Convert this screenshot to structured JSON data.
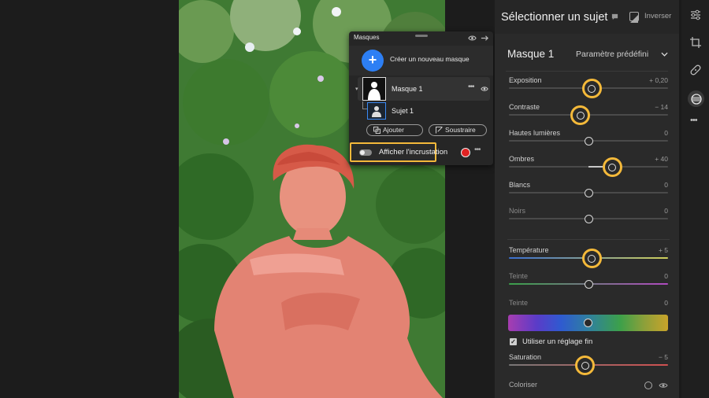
{
  "masks_panel": {
    "title": "Masques",
    "create_label": "Créer un nouveau masque",
    "create_symbol": "+",
    "mask_name": "Masque 1",
    "subject_name": "Sujet 1",
    "add_label": "Ajouter",
    "subtract_label": "Soustraire",
    "overlay_label": "Afficher l'incrustation",
    "overlay_color": "#e02222",
    "more_symbol": "•••"
  },
  "edit_panel": {
    "title": "Sélectionner un sujet",
    "invert_label": "Inverser",
    "mask_title": "Masque 1",
    "preset_label": "Paramètre prédéfini",
    "fine_tune_label": "Utiliser un réglage fin",
    "fine_tune_checked": true,
    "colorize_label": "Coloriser",
    "highlight_color": "#f4b93a",
    "sliders": [
      {
        "key": "exposure",
        "label": "Exposition",
        "value": "+ 0,20",
        "pos": 0.52,
        "highlight": true
      },
      {
        "key": "contrast",
        "label": "Contraste",
        "value": "− 14",
        "pos": 0.45,
        "highlight": true
      },
      {
        "key": "highlights",
        "label": "Hautes lumières",
        "value": "0",
        "pos": 0.5,
        "highlight": false
      },
      {
        "key": "shadows",
        "label": "Ombres",
        "value": "+ 40",
        "pos": 0.65,
        "highlight": true
      },
      {
        "key": "whites",
        "label": "Blancs",
        "value": "0",
        "pos": 0.5,
        "highlight": false
      },
      {
        "key": "blacks",
        "label": "Noirs",
        "value": "0",
        "pos": 0.5,
        "highlight": false,
        "dim": true
      },
      {
        "key": "temperature",
        "label": "Température",
        "value": "+ 5",
        "pos": 0.52,
        "highlight": true
      },
      {
        "key": "tint",
        "label": "Teinte",
        "value": "0",
        "pos": 0.5,
        "highlight": false,
        "dim": true
      },
      {
        "key": "hue",
        "label": "Teinte",
        "value": "0",
        "pos": 0.5,
        "highlight": false,
        "dim": true
      },
      {
        "key": "saturation",
        "label": "Saturation",
        "value": "− 5",
        "pos": 0.48,
        "highlight": true
      }
    ]
  },
  "tool_rail": {
    "icons": [
      "sliders-icon",
      "crop-icon",
      "healing-icon",
      "masking-icon",
      "more-icon"
    ],
    "active": "masking-icon"
  }
}
